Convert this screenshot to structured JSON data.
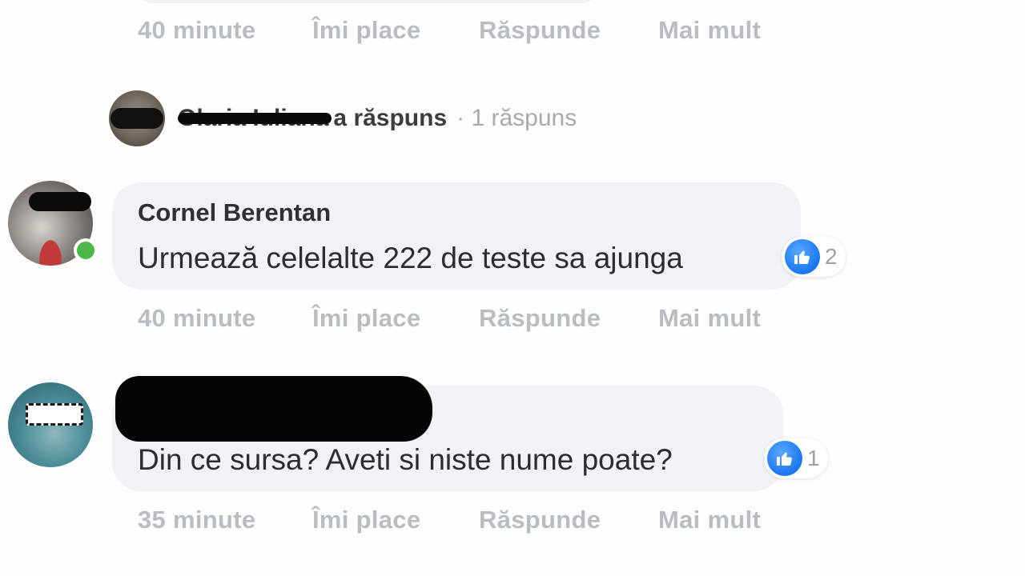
{
  "comments": [
    {
      "time": "40 minute",
      "like_label": "Îmi place",
      "reply_label": "Răspunde",
      "more_label": "Mai mult"
    },
    {
      "author": "Cornel Berentan",
      "text": "Urmează celelalte 222 de teste sa ajunga",
      "reactions": "2",
      "time": "40 minute",
      "like_label": "Îmi place",
      "reply_label": "Răspunde",
      "more_label": "Mai mult"
    },
    {
      "author": "",
      "text": "Din ce sursa? Aveti si niste nume poate?",
      "reactions": "1",
      "time": "35 minute",
      "like_label": "Îmi place",
      "reply_label": "Răspunde",
      "more_label": "Mai mult"
    }
  ],
  "reply_summary": {
    "name": "Olaria Iuliana",
    "verb": "a răspuns",
    "count": "· 1 răspuns"
  },
  "colors": {
    "bubble": "#f0f2f5",
    "action_text": "#b9bcc2",
    "like_blue": "#1877f2",
    "online_green": "#4cb848"
  },
  "icons": {
    "reaction": "like-thumb-icon",
    "presence": "online-status-icon"
  }
}
